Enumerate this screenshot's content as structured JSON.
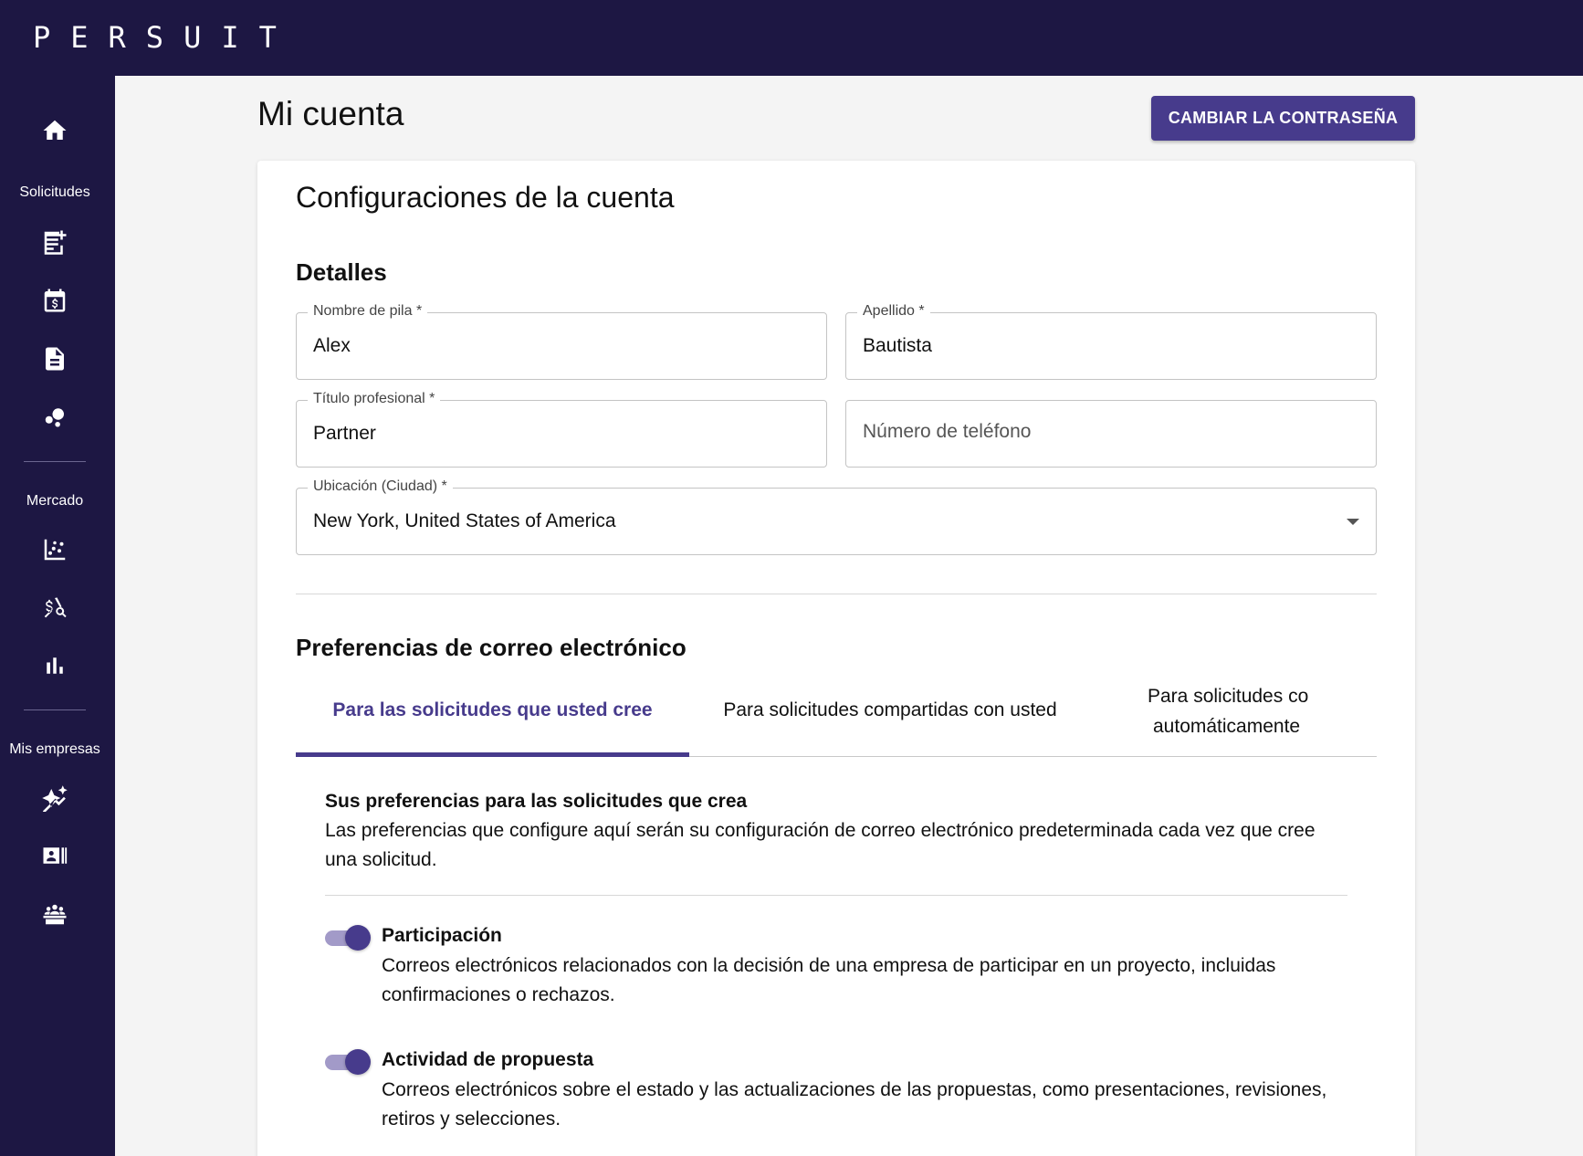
{
  "brand": {
    "logo_text": "PERSUIT"
  },
  "nav": {
    "sections": [
      {
        "label": "Solicitudes"
      },
      {
        "label": "Mercado"
      },
      {
        "label": "Mis empresas"
      }
    ],
    "icons": [
      "home-icon",
      "new-request-icon",
      "calendar-dollar-icon",
      "document-icon",
      "bubbles-icon",
      "scatter-chart-icon",
      "price-search-icon",
      "bar-chart-icon",
      "sparkle-trend-icon",
      "contact-card-icon",
      "team-icon"
    ]
  },
  "page": {
    "title": "Mi cuenta",
    "change_password_label": "CAMBIAR LA CONTRASEÑA"
  },
  "account": {
    "card_title": "Configuraciones de la cuenta",
    "details_heading": "Detalles",
    "fields": {
      "first_name": {
        "label": "Nombre de pila  *",
        "value": "Alex"
      },
      "last_name": {
        "label": "Apellido  *",
        "value": "Bautista"
      },
      "job_title": {
        "label": "Título profesional  *",
        "value": "Partner"
      },
      "phone": {
        "placeholder": "Número de teléfono",
        "value": ""
      },
      "location": {
        "label": "Ubicación (Ciudad)  *",
        "value": "New York, United States of America"
      }
    }
  },
  "email_prefs": {
    "heading": "Preferencias de correo electrónico",
    "tabs": [
      {
        "label": "Para las solicitudes que usted cree",
        "active": true
      },
      {
        "label": "Para solicitudes compartidas con usted",
        "active": false
      },
      {
        "label_line1": "Para solicitudes co",
        "label_line2": "automáticamente",
        "active": false
      }
    ],
    "panel_title": "Sus preferencias para las solicitudes que crea",
    "panel_desc": "Las preferencias que configure aquí serán su configuración de correo electrónico predeterminada cada vez que cree una solicitud.",
    "items": [
      {
        "title": "Participación",
        "desc": "Correos electrónicos relacionados con la decisión de una empresa de participar en un proyecto, incluidas confirmaciones o rechazos.",
        "enabled": true
      },
      {
        "title": "Actividad de propuesta",
        "desc": "Correos electrónicos sobre el estado y las actualizaciones de las propuestas, como presentaciones, revisiones, retiros y selecciones.",
        "enabled": true
      }
    ]
  },
  "colors": {
    "nav_bg": "#1d1743",
    "accent": "#473b8c",
    "toggle_track": "#a29ac8"
  }
}
